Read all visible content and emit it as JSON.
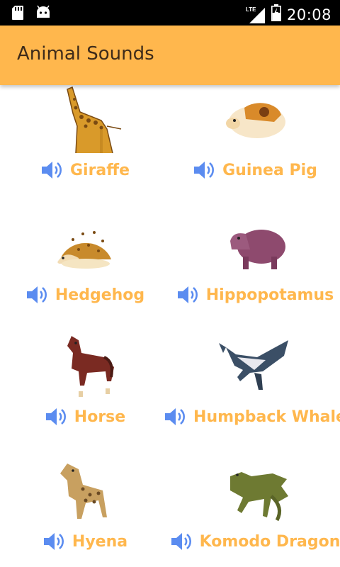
{
  "status_bar": {
    "time": "20:08",
    "network": "LTE",
    "icons": [
      "sd-card-icon",
      "android-icon",
      "lte-signal-icon",
      "battery-charging-icon"
    ]
  },
  "app_bar": {
    "title": "Animal Sounds"
  },
  "colors": {
    "accent": "#ffb74d",
    "speaker": "#5b8cf0",
    "title_text": "#3e2b1a"
  },
  "animals": [
    {
      "name": "Giraffe"
    },
    {
      "name": "Guinea Pig"
    },
    {
      "name": "Hedgehog"
    },
    {
      "name": "Hippopotamus"
    },
    {
      "name": "Horse"
    },
    {
      "name": "Humpback Whale"
    },
    {
      "name": "Hyena"
    },
    {
      "name": "Komodo Dragon"
    }
  ]
}
